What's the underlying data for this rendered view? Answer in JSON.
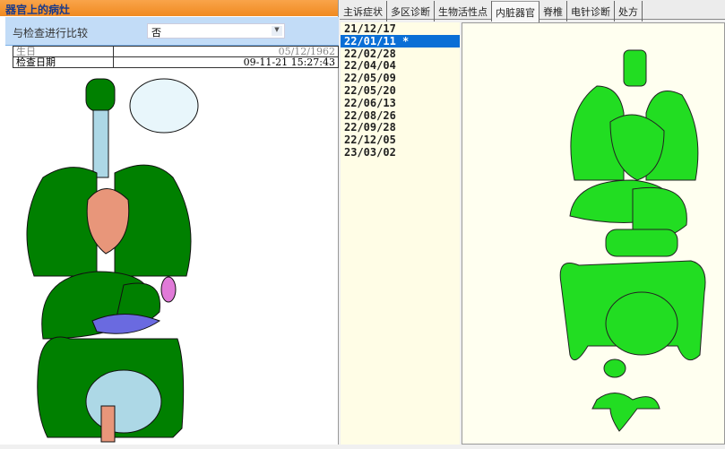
{
  "left_panel": {
    "title": "器官上的病灶",
    "compare_label": "与检查进行比较",
    "compare_value": "否",
    "info": [
      {
        "label": "生日",
        "value": "05/12/1962"
      },
      {
        "label": "检查日期",
        "value": "09-11-21 15:27:43"
      }
    ]
  },
  "tabs": [
    {
      "label": "主诉症状"
    },
    {
      "label": "多区诊断"
    },
    {
      "label": "生物活性点"
    },
    {
      "label": "内脏器官",
      "active": true
    },
    {
      "label": "脊椎"
    },
    {
      "label": "电针诊断"
    },
    {
      "label": "处方"
    }
  ],
  "dates": [
    "21/12/17",
    "22/01/11 *",
    "22/02/28",
    "22/04/04",
    "22/05/09",
    "22/05/20",
    "22/06/13",
    "22/08/26",
    "22/09/28",
    "22/12/05",
    "23/03/02"
  ],
  "selected_date_index": 1,
  "colors": {
    "organ_left": "#008000",
    "organ_right": "#22dd22",
    "selection": "#0a6fd6",
    "header": "#f39436"
  }
}
